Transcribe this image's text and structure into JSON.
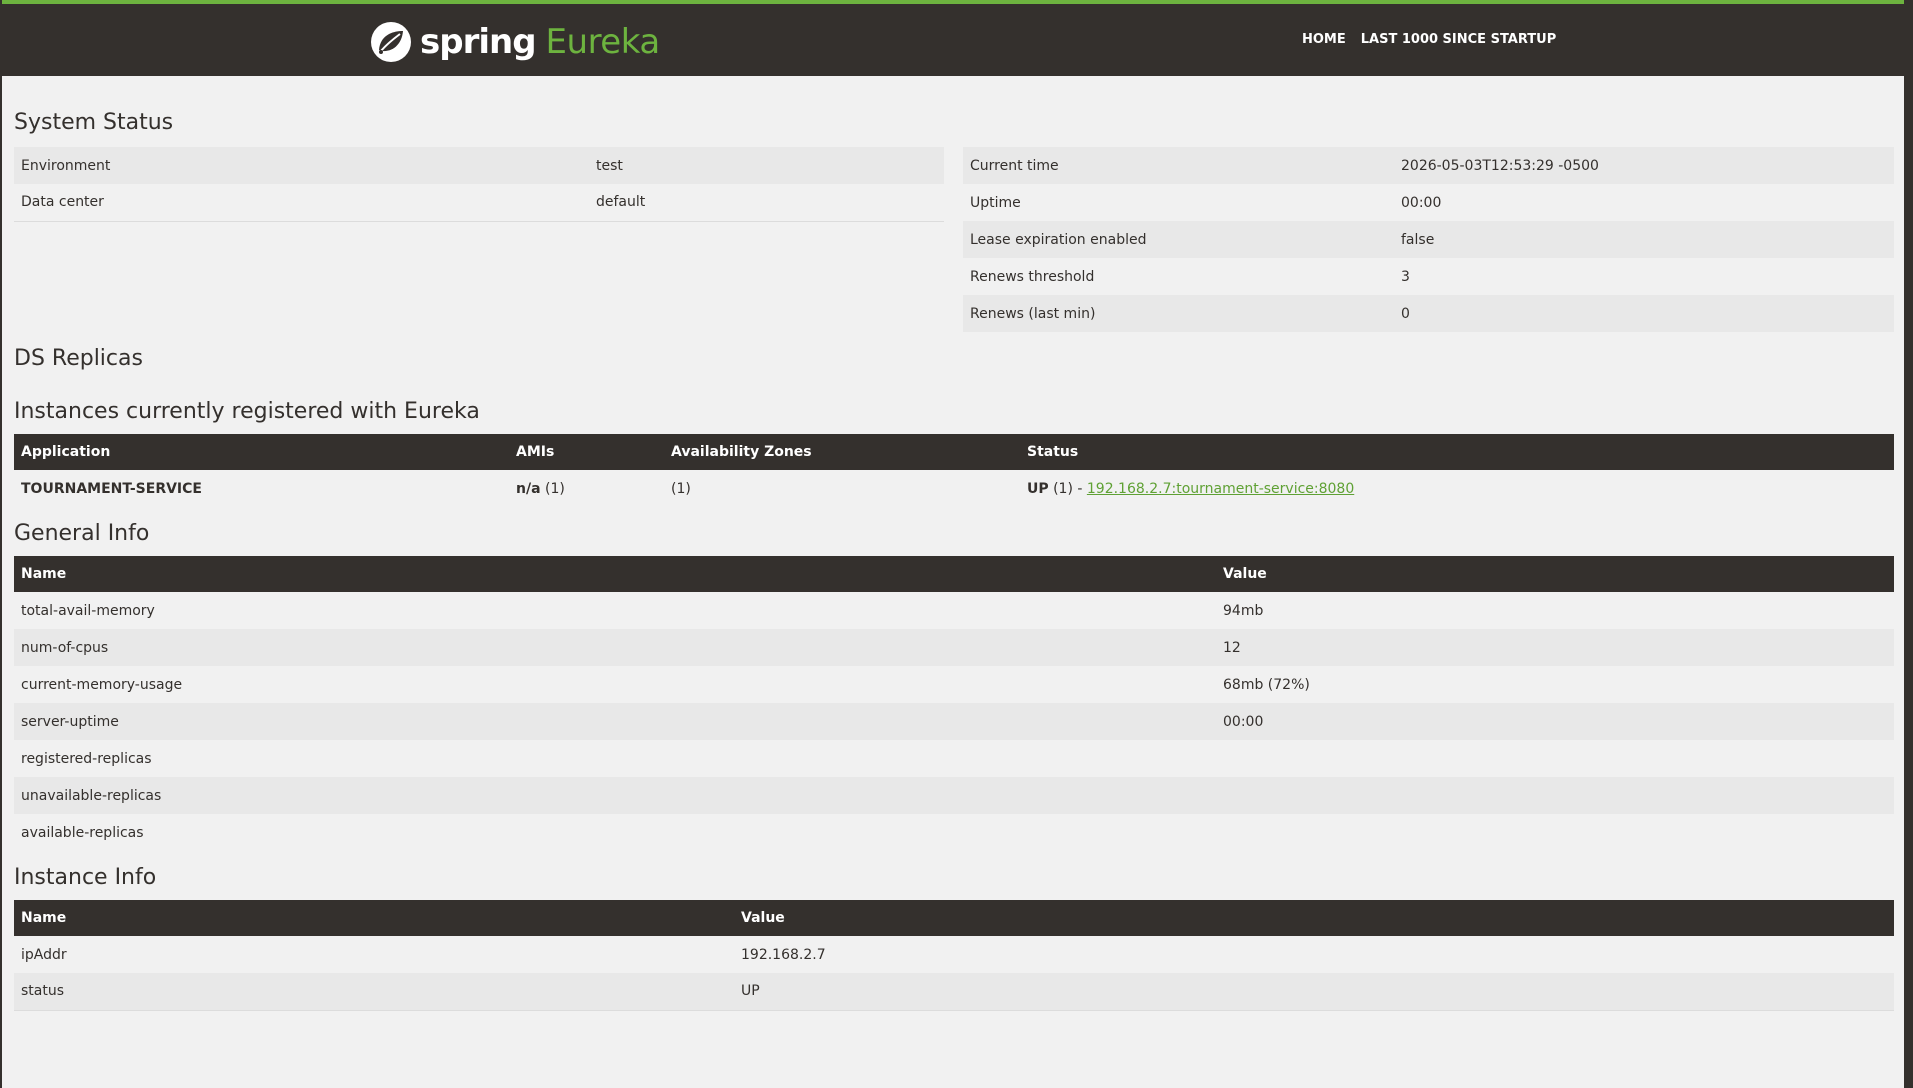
{
  "brand": {
    "spring": "spring",
    "eureka": "Eureka"
  },
  "nav": {
    "home": "HOME",
    "last1000": "LAST 1000 SINCE STARTUP"
  },
  "system_status": {
    "title": "System Status",
    "left": [
      {
        "name": "Environment",
        "value": "test"
      },
      {
        "name": "Data center",
        "value": "default"
      }
    ],
    "right": [
      {
        "name": "Current time",
        "value": "2026-05-03T12:53:29 -0500"
      },
      {
        "name": "Uptime",
        "value": "00:00"
      },
      {
        "name": "Lease expiration enabled",
        "value": "false"
      },
      {
        "name": "Renews threshold",
        "value": "3"
      },
      {
        "name": "Renews (last min)",
        "value": "0"
      }
    ]
  },
  "ds_replicas": {
    "title": "DS Replicas"
  },
  "instances": {
    "title": "Instances currently registered with Eureka",
    "headers": [
      "Application",
      "AMIs",
      "Availability Zones",
      "Status"
    ],
    "rows": [
      {
        "application": "TOURNAMENT-SERVICE",
        "amis_bold": "n/a",
        "amis_count": " (1)",
        "zones": "(1)",
        "status_bold": "UP",
        "status_count": " (1) - ",
        "link": "192.168.2.7:tournament-service:8080"
      }
    ]
  },
  "general_info": {
    "title": "General Info",
    "headers": [
      "Name",
      "Value"
    ],
    "rows": [
      {
        "name": "total-avail-memory",
        "value": "94mb"
      },
      {
        "name": "num-of-cpus",
        "value": "12"
      },
      {
        "name": "current-memory-usage",
        "value": "68mb (72%)"
      },
      {
        "name": "server-uptime",
        "value": "00:00"
      },
      {
        "name": "registered-replicas",
        "value": ""
      },
      {
        "name": "unavailable-replicas",
        "value": ""
      },
      {
        "name": "available-replicas",
        "value": ""
      }
    ]
  },
  "instance_info": {
    "title": "Instance Info",
    "headers": [
      "Name",
      "Value"
    ],
    "rows": [
      {
        "name": "ipAddr",
        "value": "192.168.2.7"
      },
      {
        "name": "status",
        "value": "UP"
      }
    ]
  },
  "colors": {
    "dark": "#34302d",
    "green": "#6db33f",
    "link": "#5fa134",
    "row_alt": "#e8e8e8",
    "bg": "#f1f1f1"
  },
  "icons": {
    "logo": "spring-leaf-icon"
  }
}
